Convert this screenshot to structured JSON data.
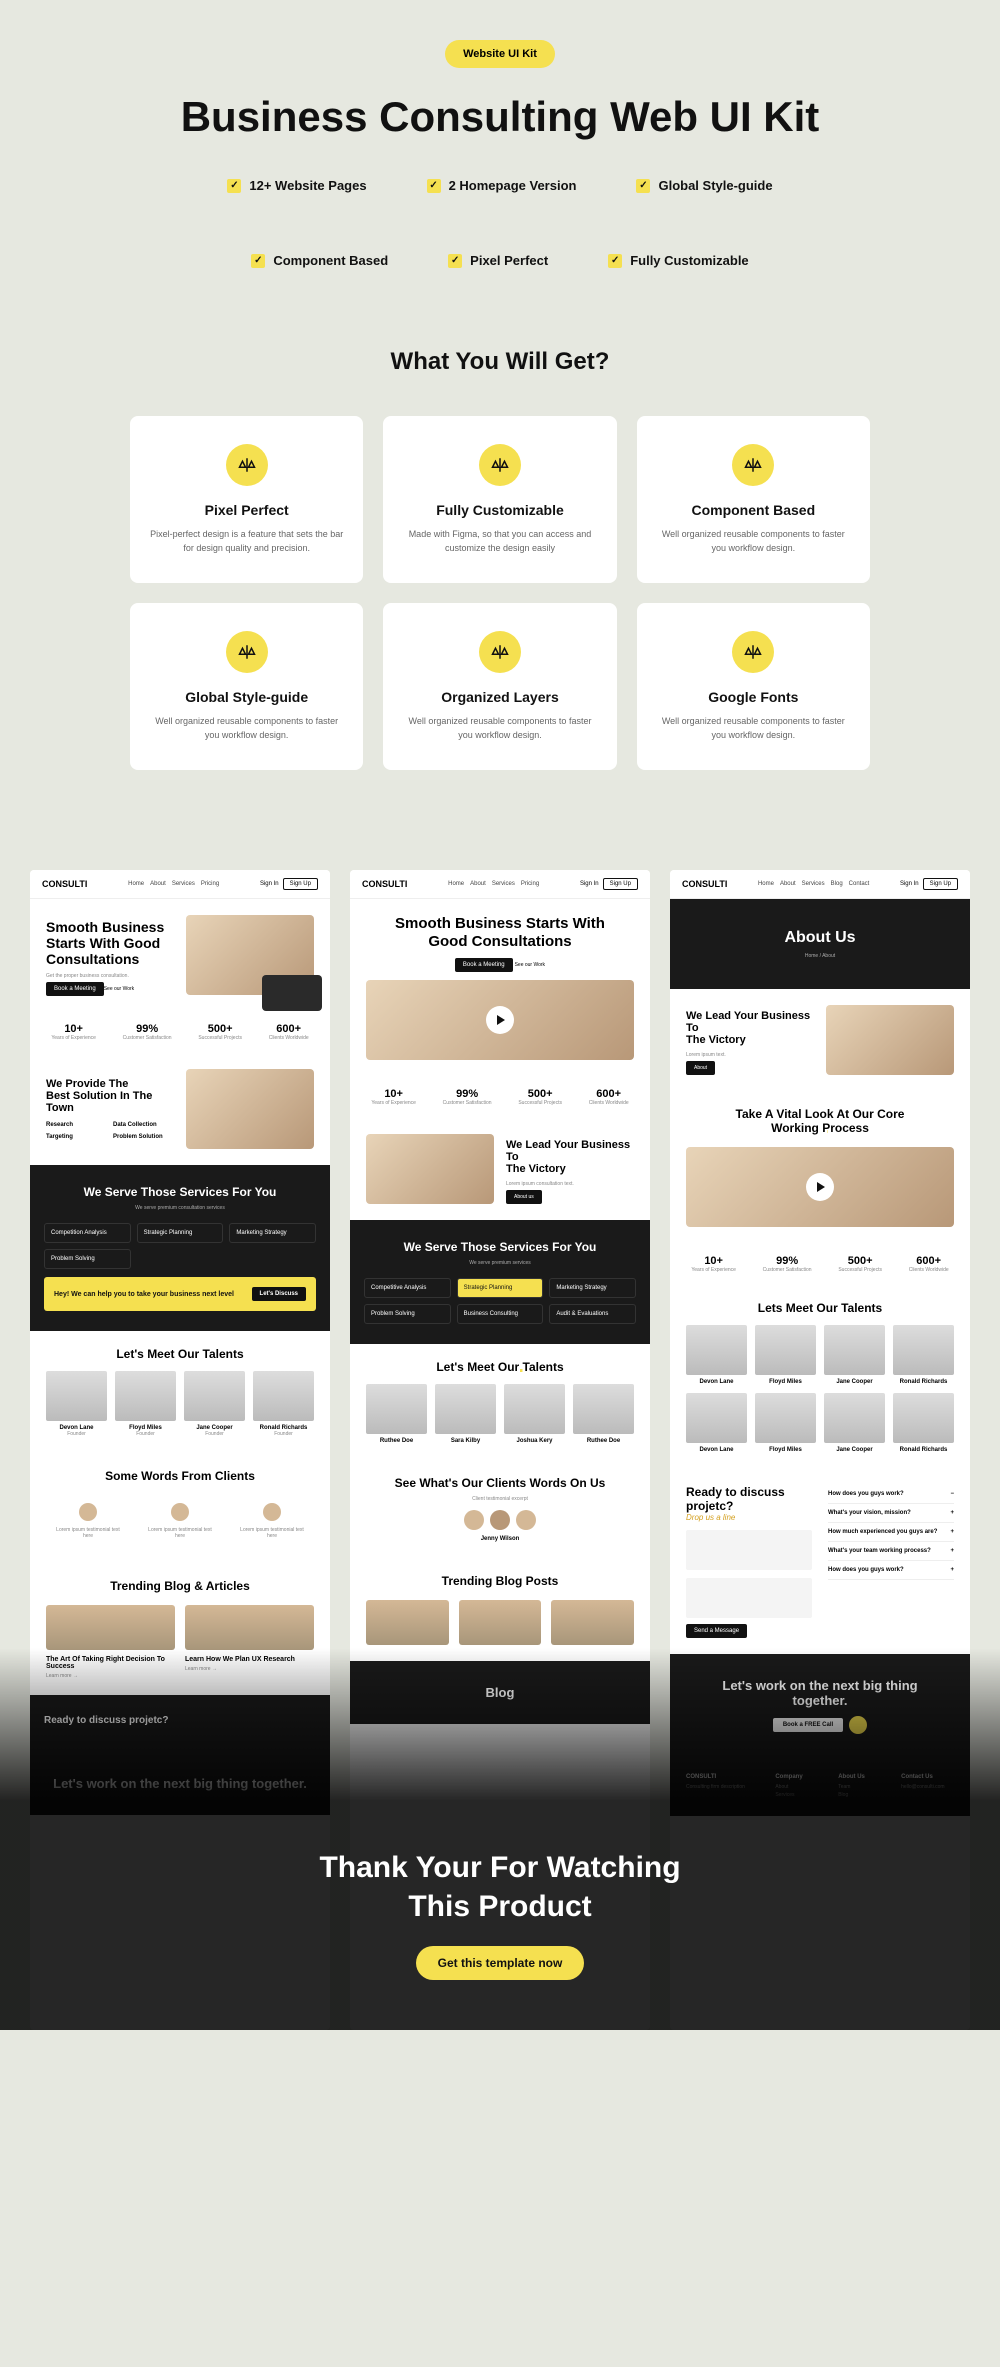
{
  "badge": "Website UI Kit",
  "title": "Business Consulting Web UI Kit",
  "features_row1": [
    "12+ Website Pages",
    "2 Homepage Version",
    "Global Style-guide"
  ],
  "features_row2": [
    "Component Based",
    "Pixel Perfect",
    "Fully Customizable"
  ],
  "what_title": "What You Will Get?",
  "cards": [
    {
      "title": "Pixel Perfect",
      "desc": "Pixel-perfect design is a feature that sets the bar for design quality and precision."
    },
    {
      "title": "Fully Customizable",
      "desc": "Made with Figma, so that you can access and customize the design easily"
    },
    {
      "title": "Component Based",
      "desc": "Well organized reusable components to faster you workflow design."
    },
    {
      "title": "Global Style-guide",
      "desc": "Well organized reusable components to faster you workflow design."
    },
    {
      "title": "Organized Layers",
      "desc": "Well organized reusable components to faster you workflow design."
    },
    {
      "title": "Google Fonts",
      "desc": "Well organized reusable components to faster you workflow design."
    }
  ],
  "brand": "CONSULTI",
  "nav_links": [
    "Home",
    "About",
    "Services",
    "Pricing",
    "Blog",
    "Contact"
  ],
  "nav_signin": "Sign In",
  "nav_signup": "Sign Up",
  "p1": {
    "hero_l1": "Smooth Business",
    "hero_l2": "Starts With Good",
    "hero_l3": "Consultations",
    "cta": "Book a Meeting",
    "cta2": "See our Work",
    "sol_title_a": "We Provide The",
    "sol_title_b": "Best Solution",
    "sol_title_c": "In The Town",
    "sol_items": [
      "Research",
      "Data Collection",
      "Targeting",
      "Problem Solution"
    ],
    "svc_title": "We Serve  Those Services For You",
    "svc": [
      "Competition Analysis",
      "Strategic Planning",
      "Marketing Strategy",
      "Problem Solving"
    ],
    "svc_promo": "Hey! We can help you to take your business next level",
    "svc_promo_btn": "Let's Discuss",
    "talents_title_a": "Let's Meet Our",
    "talents_title_b": "Talents",
    "talents": [
      {
        "name": "Devon Lane",
        "role": "Founder"
      },
      {
        "name": "Floyd Miles",
        "role": "Founder"
      },
      {
        "name": "Jane Cooper",
        "role": "Founder"
      },
      {
        "name": "Ronald Richards",
        "role": "Founder"
      }
    ],
    "testi_title": "Some Words From Clients",
    "blog_title": "Trending Blog & Articles",
    "blog": [
      {
        "title": "The Art Of Taking Right Decision To Success"
      },
      {
        "title": "Learn How We Plan UX Research"
      }
    ],
    "discuss": "Ready to discuss projetc?"
  },
  "stats": [
    {
      "num": "10+",
      "lbl": "Years of Experience"
    },
    {
      "num": "99%",
      "lbl": "Customer Satisfaction"
    },
    {
      "num": "500+",
      "lbl": "Successful Projects"
    },
    {
      "num": "600+",
      "lbl": "Clients Worldwide"
    }
  ],
  "p2": {
    "hero_l1": "Smooth Business Starts With",
    "hero_l2": "Good",
    "hero_l3": "Consultations",
    "victory_a": "We Lead Your Business To",
    "victory_b": "The Victory",
    "svc_title": "We Serve  Those Services For You",
    "svc": [
      "Competitive Analysis",
      "Strategic Planning",
      "Marketing Strategy",
      "Problem Solving",
      "Business Consulting",
      "Audit & Evaluations"
    ],
    "talents_title_a": "Let's Meet",
    "talents_title_b": "Our Talents",
    "talents": [
      {
        "name": "Ruthee Doe"
      },
      {
        "name": "Sara Kilby"
      },
      {
        "name": "Joshua Kery"
      },
      {
        "name": "Ruthee Doe"
      }
    ],
    "clients_title": "See What's Our Clients Words On Us",
    "client_name": "Jenny Wilson",
    "blog_title": "Trending Blog Posts"
  },
  "p3": {
    "about_title": "About Us",
    "bc": "Home / About",
    "victory_a": "We Lead Your Business To",
    "victory_b": "The Victory",
    "process_a": "Take A Vital Look At Our Core",
    "process_b": "Working Process",
    "talents_title_a": "Lets Meet Our",
    "talents_title_b": "Talents",
    "talents": [
      {
        "name": "Devon Lane"
      },
      {
        "name": "Floyd Miles"
      },
      {
        "name": "Jane Cooper"
      },
      {
        "name": "Ronald Richards"
      },
      {
        "name": "Devon Lane"
      },
      {
        "name": "Floyd Miles"
      },
      {
        "name": "Jane Cooper"
      },
      {
        "name": "Ronald Richards"
      }
    ],
    "discuss": "Ready to discuss projetc?",
    "drop": "Drop us a line",
    "send": "Send a Message",
    "faq": [
      "How does you guys work?",
      "What's your vision, mission?",
      "How much experienced you guys are?",
      "What's your team working process?",
      "How does you guys work?"
    ],
    "cta_l1": "Let's work on the next big thing",
    "cta_l2": "together.",
    "cta_btn": "Book a FREE Call",
    "footer_cols": [
      "Company",
      "About Us",
      "Contact Us"
    ]
  },
  "thanks_l1": "Thank Your For Watching",
  "thanks_l2": "This Product",
  "thanks_btn": "Get this template now"
}
